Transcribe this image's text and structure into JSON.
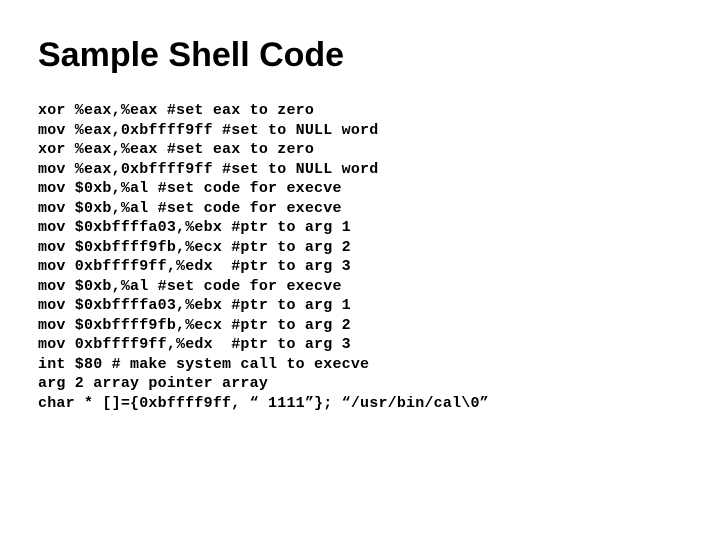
{
  "title": "Sample Shell Code",
  "code_lines": [
    "xor %eax,%eax #set eax to zero",
    "mov %eax,0xbffff9ff #set to NULL word",
    "xor %eax,%eax #set eax to zero",
    "mov %eax,0xbffff9ff #set to NULL word",
    "mov $0xb,%al #set code for execve",
    "mov $0xb,%al #set code for execve",
    "mov $0xbffffa03,%ebx #ptr to arg 1",
    "mov $0xbffff9fb,%ecx #ptr to arg 2",
    "mov 0xbffff9ff,%edx  #ptr to arg 3",
    "mov $0xb,%al #set code for execve",
    "mov $0xbffffa03,%ebx #ptr to arg 1",
    "mov $0xbffff9fb,%ecx #ptr to arg 2",
    "mov 0xbffff9ff,%edx  #ptr to arg 3",
    "int $80 # make system call to execve",
    "arg 2 array pointer array",
    "char * []={0xbffff9ff, “ 1111”}; “/usr/bin/cal\\0”"
  ]
}
